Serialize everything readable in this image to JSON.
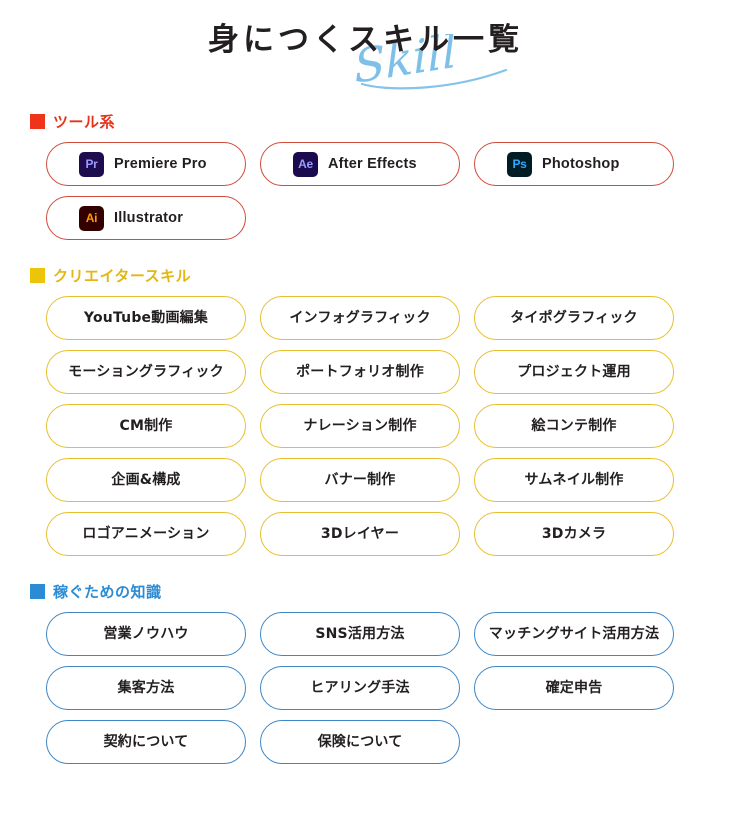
{
  "title": {
    "main": "身につくスキル一覧",
    "script": "Skill",
    "script_color": "#7ec0e8",
    "main_color": "#231f20"
  },
  "sections": [
    {
      "id": "tools",
      "heading": "ツール系",
      "bullet_color": "#f0331b",
      "heading_color": "#e8321c",
      "pill_border_color": "#cf4b3c",
      "items": [
        {
          "label": "Premiere Pro",
          "icon_name": "premiere-pro-icon",
          "icon_text": "Pr",
          "icon_bg": "#1e0c4e",
          "icon_fg": "#9a9bff"
        },
        {
          "label": "After Effects",
          "icon_name": "after-effects-icon",
          "icon_text": "Ae",
          "icon_bg": "#1c0a4e",
          "icon_fg": "#9a9bff"
        },
        {
          "label": "Photoshop",
          "icon_name": "photoshop-icon",
          "icon_text": "Ps",
          "icon_bg": "#001d26",
          "icon_fg": "#31a8ff"
        },
        {
          "label": "Illustrator",
          "icon_name": "illustrator-icon",
          "icon_text": "Ai",
          "icon_bg": "#330000",
          "icon_fg": "#ff9a00"
        }
      ]
    },
    {
      "id": "creator",
      "heading": "クリエイタースキル",
      "bullet_color": "#ecc40a",
      "heading_color": "#e3b712",
      "pill_border_color": "#e7bf2e",
      "items": [
        {
          "label": "YouTube動画編集"
        },
        {
          "label": "インフォグラフィック"
        },
        {
          "label": "タイポグラフィック"
        },
        {
          "label": "モーショングラフィック"
        },
        {
          "label": "ポートフォリオ制作"
        },
        {
          "label": "プロジェクト運用"
        },
        {
          "label": "CM制作"
        },
        {
          "label": "ナレーション制作"
        },
        {
          "label": "絵コンテ制作"
        },
        {
          "label": "企画&構成"
        },
        {
          "label": "バナー制作"
        },
        {
          "label": "サムネイル制作"
        },
        {
          "label": "ロゴアニメーション"
        },
        {
          "label": "3Dレイヤー"
        },
        {
          "label": "3Dカメラ"
        }
      ]
    },
    {
      "id": "knowledge",
      "heading": "稼ぐための知識",
      "bullet_color": "#2b8bd4",
      "heading_color": "#2b8bd4",
      "pill_border_color": "#3e86c4",
      "items": [
        {
          "label": "営業ノウハウ"
        },
        {
          "label": "SNS活用方法"
        },
        {
          "label": "マッチングサイト活用方法"
        },
        {
          "label": "集客方法"
        },
        {
          "label": "ヒアリング手法"
        },
        {
          "label": "確定申告"
        },
        {
          "label": "契約について"
        },
        {
          "label": "保険について"
        }
      ]
    }
  ]
}
